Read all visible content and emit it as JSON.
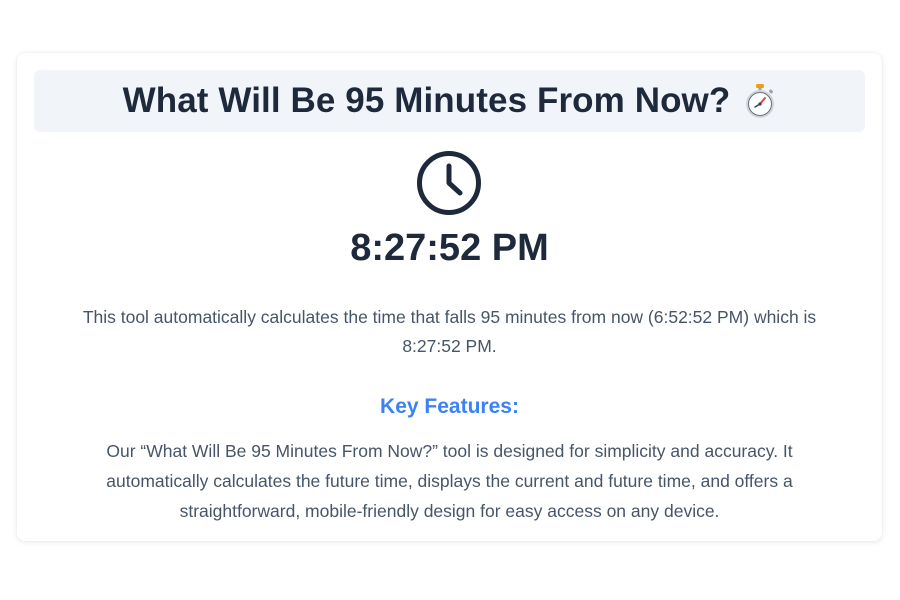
{
  "header": {
    "title": "What Will Be 95 Minutes From Now?",
    "title_icon": "stopwatch-icon"
  },
  "result": {
    "icon": "clock-icon",
    "future_time": "8:27:52 PM"
  },
  "description": {
    "text": "This tool automatically calculates the time that falls 95 minutes from now (6:52:52 PM) which is 8:27:52 PM."
  },
  "features": {
    "heading": "Key Features:",
    "text": "Our “What Will Be 95 Minutes From Now?” tool is designed for simplicity and accuracy. It automatically calculates the future time, displays the current and future time, and offers a straightforward, mobile-friendly design for easy access on any device."
  },
  "colors": {
    "accent": "#3b82f6",
    "title_text": "#1e293b",
    "body_text": "#475569",
    "title_band": "#f1f5f9"
  }
}
